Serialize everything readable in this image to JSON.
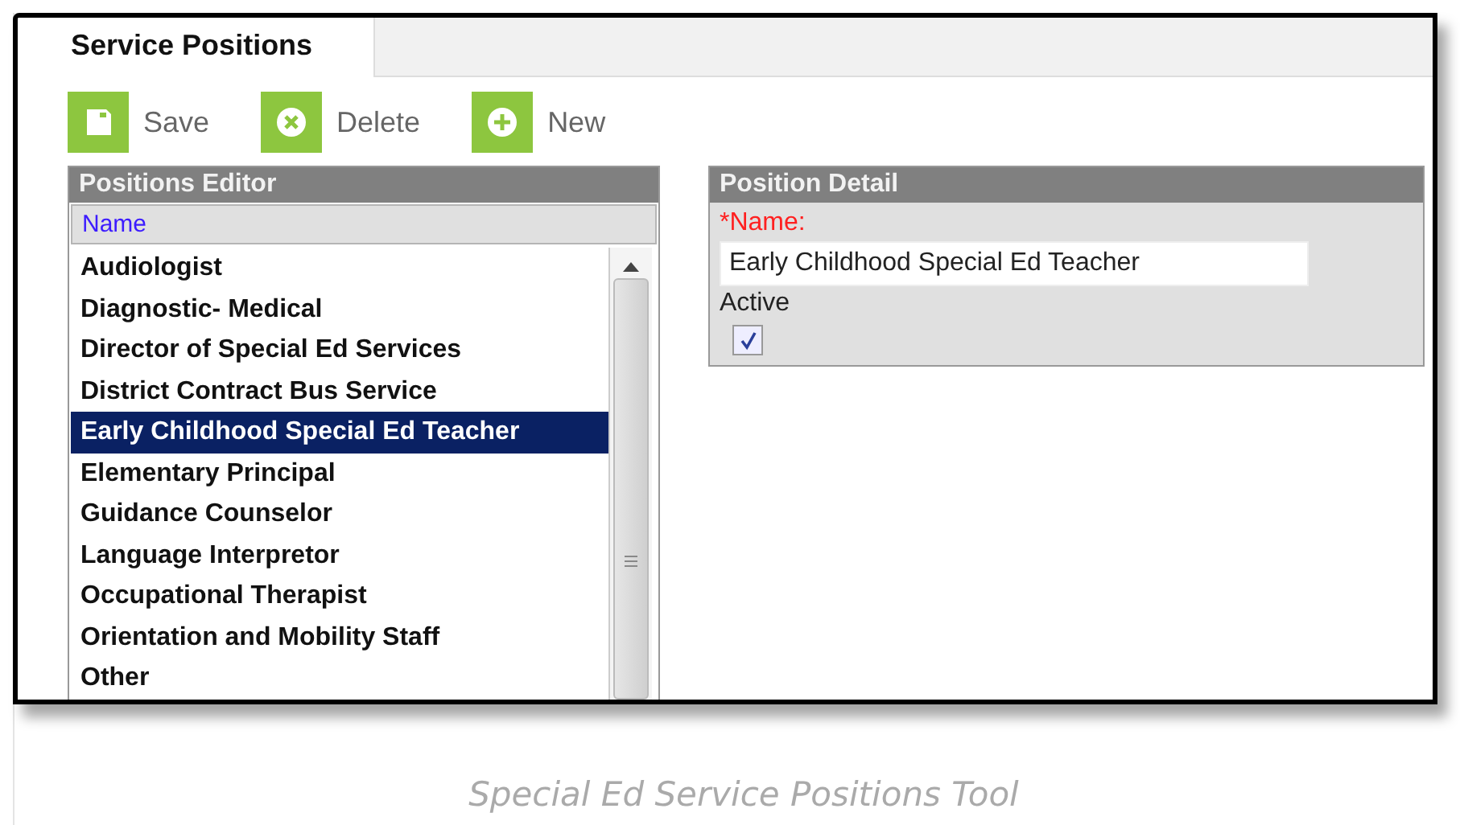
{
  "tab": {
    "label": "Service Positions",
    "selected": true
  },
  "toolbar": [
    {
      "kind": "save",
      "label": "Save"
    },
    {
      "kind": "delete",
      "label": "Delete"
    },
    {
      "kind": "new",
      "label": "New"
    }
  ],
  "positions_editor": {
    "title": "Positions Editor",
    "column": "Name",
    "items": [
      {
        "label": "Audiologist",
        "selected": false
      },
      {
        "label": "Diagnostic- Medical",
        "selected": false
      },
      {
        "label": "Director of Special Ed Services",
        "selected": false
      },
      {
        "label": "District Contract Bus Service",
        "selected": false
      },
      {
        "label": "Early Childhood Special Ed Teacher",
        "selected": true
      },
      {
        "label": "Elementary Principal",
        "selected": false
      },
      {
        "label": "Guidance Counselor",
        "selected": false
      },
      {
        "label": "Language Interpretor",
        "selected": false
      },
      {
        "label": "Occupational Therapist",
        "selected": false
      },
      {
        "label": "Orientation and Mobility Staff",
        "selected": false
      },
      {
        "label": "Other",
        "selected": false
      }
    ]
  },
  "position_detail": {
    "title": "Position Detail",
    "name_label": "*Name:",
    "name_value": "Early Childhood Special Ed Teacher",
    "active_label": "Active",
    "active": true
  },
  "caption": "Special Ed Service Positions Tool"
}
